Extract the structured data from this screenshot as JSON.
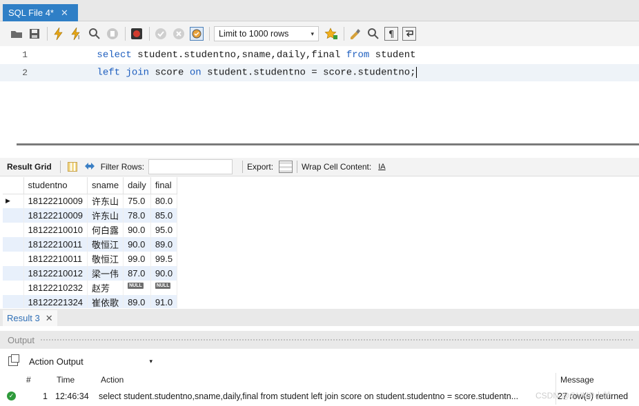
{
  "editor_tab": {
    "title": "SQL File 4*",
    "close": "✕"
  },
  "toolbar": {
    "icons": [
      "folder-icon",
      "save-icon",
      "execute-icon",
      "execute-current-icon",
      "explain-icon",
      "stop-icon",
      "toggle-error-icon",
      "commit-icon",
      "rollback-icon",
      "autocommit-icon"
    ],
    "limit_label": "Limit to 1000 rows",
    "caret": "▾"
  },
  "editor": {
    "lines": [
      {
        "num": "1",
        "tokens": [
          {
            "t": "select",
            "kw": true
          },
          {
            "t": " student.studentno,sname,daily,final ",
            "kw": false
          },
          {
            "t": "from",
            "kw": true
          },
          {
            "t": " student",
            "kw": false
          }
        ]
      },
      {
        "num": "2",
        "tokens": [
          {
            "t": "left",
            "kw": true
          },
          {
            "t": " ",
            "kw": false
          },
          {
            "t": "join",
            "kw": true
          },
          {
            "t": " score ",
            "kw": false
          },
          {
            "t": "on",
            "kw": true
          },
          {
            "t": " student.studentno = score.studentno;",
            "kw": false
          }
        ]
      }
    ]
  },
  "result_toolbar": {
    "result_grid": "Result Grid",
    "filter_rows": "Filter Rows:",
    "export": "Export:",
    "wrap_cell": "Wrap Cell Content:",
    "wrap_icon": "IA"
  },
  "grid": {
    "columns": [
      "studentno",
      "sname",
      "daily",
      "final"
    ],
    "rows": [
      {
        "studentno": "18122210009",
        "sname": "许东山",
        "daily": "75.0",
        "final": "80.0"
      },
      {
        "studentno": "18122210009",
        "sname": "许东山",
        "daily": "78.0",
        "final": "85.0"
      },
      {
        "studentno": "18122210010",
        "sname": "何白露",
        "daily": "90.0",
        "final": "95.0"
      },
      {
        "studentno": "18122210011",
        "sname": "敬恒江",
        "daily": "90.0",
        "final": "89.0"
      },
      {
        "studentno": "18122210011",
        "sname": "敬恒江",
        "daily": "99.0",
        "final": "99.5"
      },
      {
        "studentno": "18122210012",
        "sname": "梁一伟",
        "daily": "87.0",
        "final": "90.0"
      },
      {
        "studentno": "18122210232",
        "sname": "赵芳",
        "daily": "NULL",
        "final": "NULL"
      },
      {
        "studentno": "18122221324",
        "sname": "崔依歌",
        "daily": "89.0",
        "final": "91.0"
      }
    ],
    "current_row_marker": "▶"
  },
  "result_tab": {
    "label": "Result 3",
    "close": "✕"
  },
  "output": {
    "header": "Output",
    "selector": "Action Output",
    "columns": {
      "num": "#",
      "time": "Time",
      "action": "Action",
      "message": "Message"
    },
    "row": {
      "num": "1",
      "time": "12:46:34",
      "action": "select student.studentno,sname,daily,final from student  left join score on student.studentno = score.studentn...",
      "message": "27 row(s) returned"
    }
  },
  "watermark": "CSDN @GUMP小甘"
}
